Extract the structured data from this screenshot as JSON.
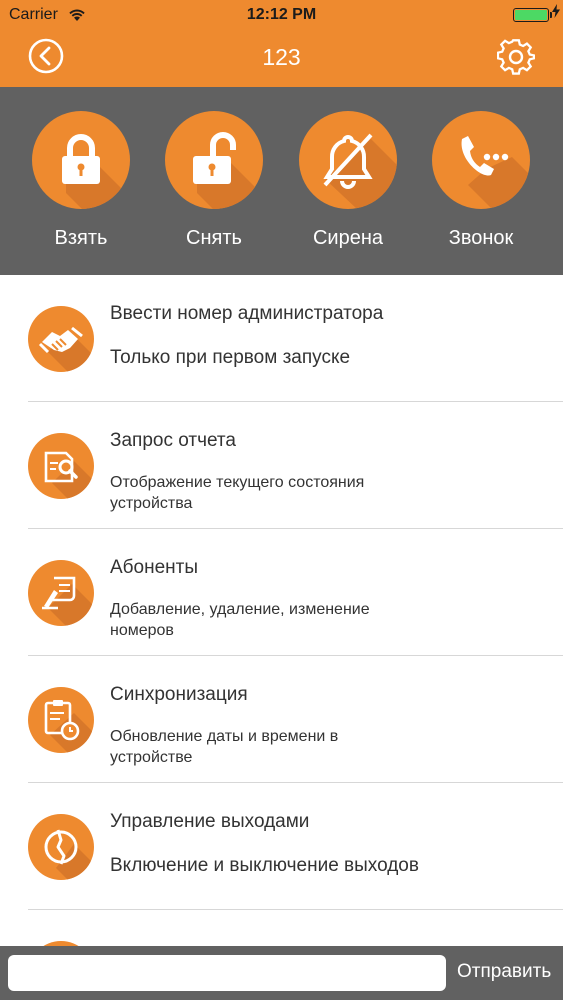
{
  "status": {
    "carrier": "Carrier",
    "time": "12:12 PM"
  },
  "nav": {
    "title": "123"
  },
  "actions": [
    {
      "label": "Взять",
      "icon": "lock-closed-icon"
    },
    {
      "label": "Снять",
      "icon": "lock-open-icon"
    },
    {
      "label": "Сирена",
      "icon": "bell-off-icon"
    },
    {
      "label": "Звонок",
      "icon": "phone-dots-icon"
    }
  ],
  "list": [
    {
      "title": "Ввести номер администратора",
      "subtitle": "Только при первом запуске",
      "icon": "handshake-icon"
    },
    {
      "title": "Запрос отчета",
      "subtitle_line1": "Отображение текущего состояния",
      "subtitle_line2": "устройства",
      "icon": "report-search-icon"
    },
    {
      "title": "Абоненты",
      "subtitle_line1": "Добавление, удаление, изменение",
      "subtitle_line2": "номеров",
      "icon": "subscribers-icon"
    },
    {
      "title": "Синхронизация",
      "subtitle_line1": "Обновление даты и времени в",
      "subtitle_line2": "устройстве",
      "icon": "clipboard-clock-icon"
    },
    {
      "title": "Управление выходами",
      "subtitle": "Включение и выключение выходов",
      "icon": "outputs-icon"
    }
  ],
  "bottom": {
    "input_value": "",
    "input_placeholder": "",
    "send_label": "Отправить"
  },
  "colors": {
    "accent": "#ee8a2f",
    "panel": "#616161",
    "text": "#333333",
    "separator": "#d7d7d7"
  }
}
